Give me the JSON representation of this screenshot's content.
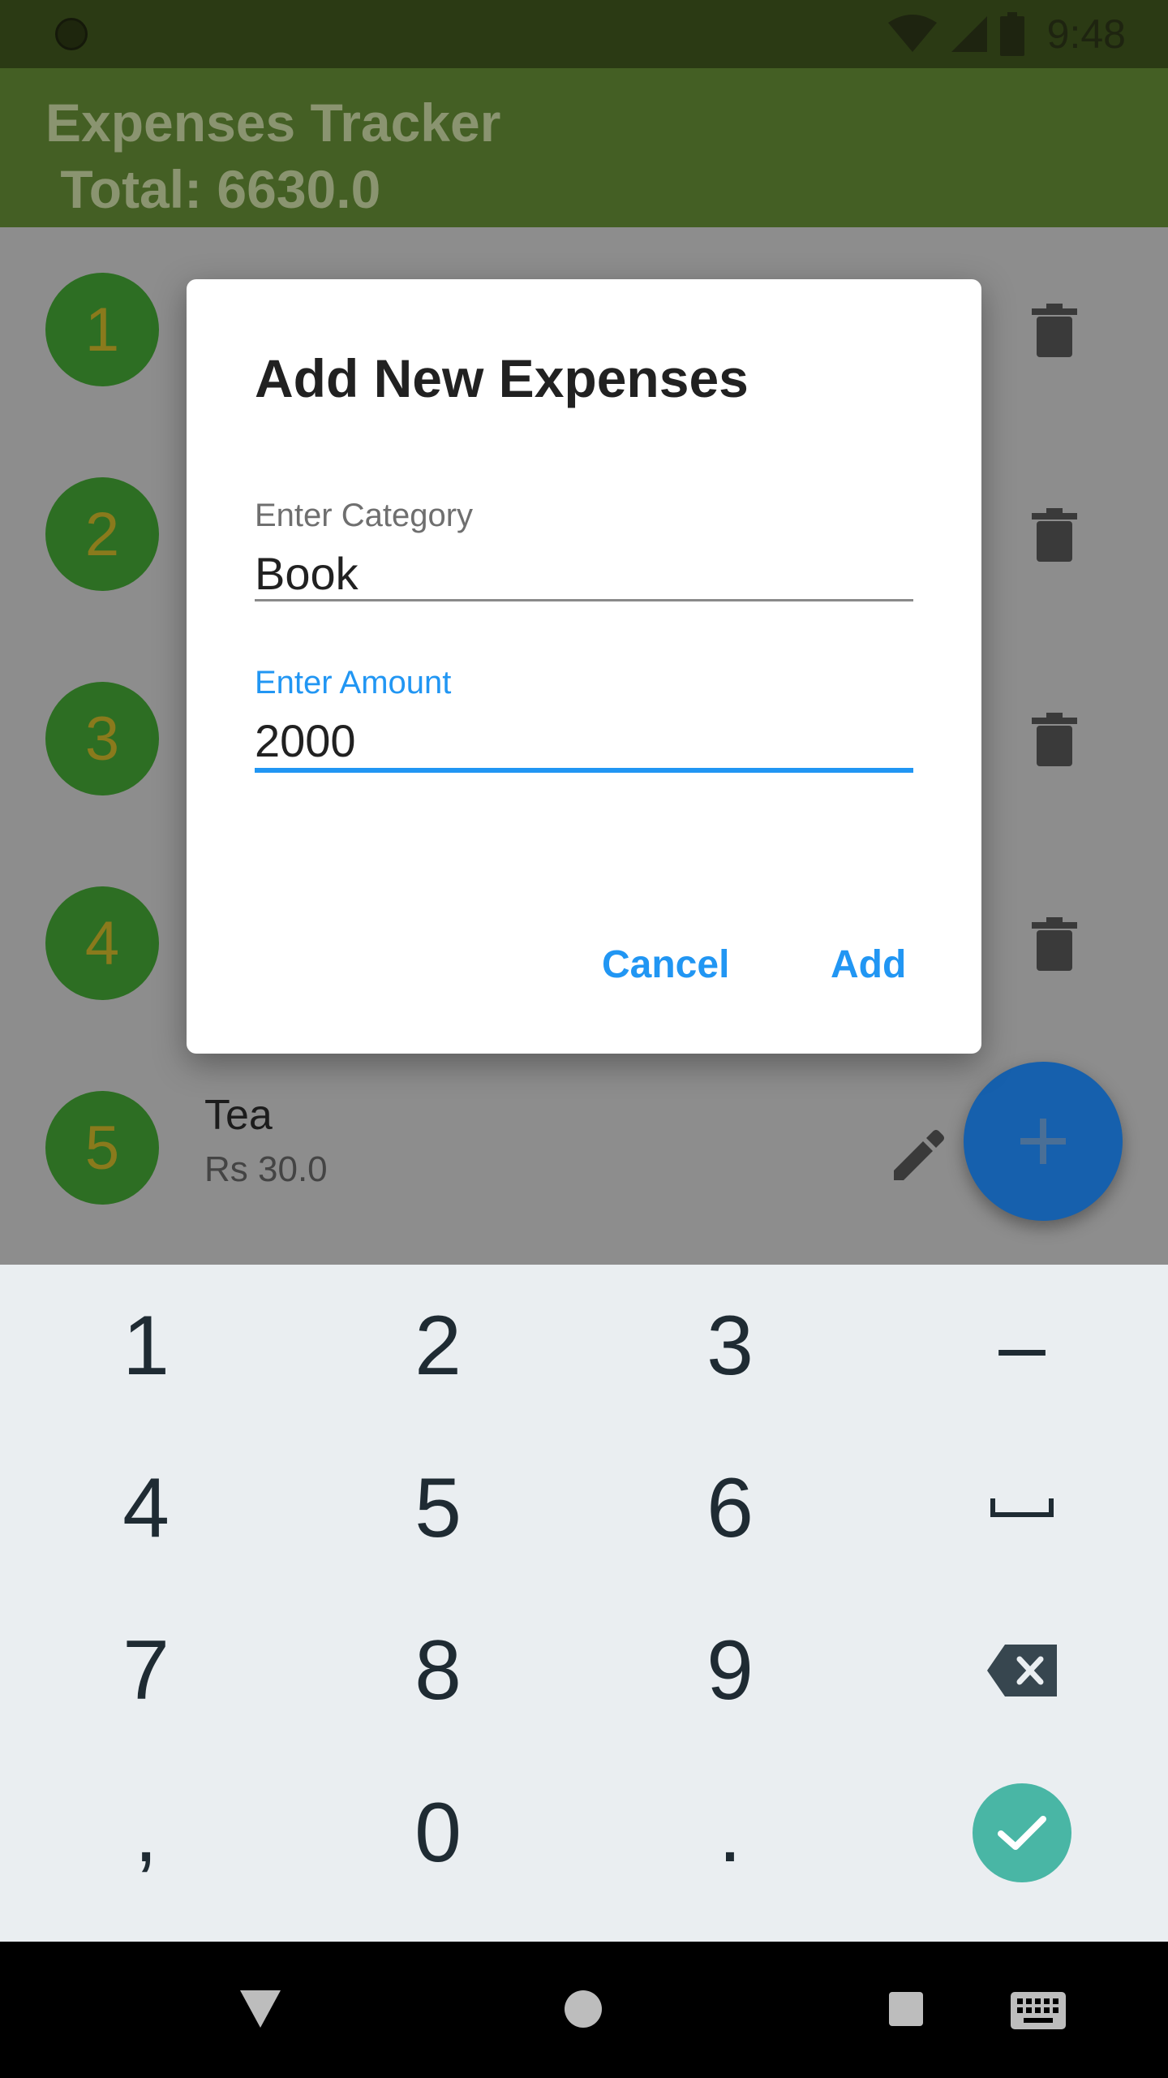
{
  "status_bar": {
    "time": "9:48"
  },
  "app_bar": {
    "title": "Expenses Tracker\n Total: 6630.0"
  },
  "list": {
    "items": [
      {
        "index": "1"
      },
      {
        "index": "2"
      },
      {
        "index": "3"
      },
      {
        "index": "4"
      },
      {
        "index": "5",
        "title": "Tea",
        "amount": "Rs 30.0"
      }
    ]
  },
  "dialog": {
    "title": "Add New Expenses",
    "category_label": "Enter Category",
    "category_value": "Book",
    "amount_label": "Enter Amount",
    "amount_value": "2000",
    "cancel_label": "Cancel",
    "add_label": "Add"
  },
  "keyboard": {
    "keys": [
      "1",
      "2",
      "3",
      "–",
      "4",
      "5",
      "6",
      "",
      "7",
      "8",
      "9",
      "",
      ",",
      "0",
      ".",
      ""
    ]
  },
  "colors": {
    "accent": "#2196f3",
    "app_bar": "#445f24",
    "fab": "#1660ad",
    "avatar": "#2d6e23",
    "done_key": "#49b6a5"
  },
  "icons": {
    "status": [
      "wifi-icon",
      "signal-icon",
      "battery-icon"
    ],
    "list_row": [
      "trash-icon",
      "edit-icon"
    ],
    "fab": "plus-icon",
    "keyboard": [
      "space-icon",
      "backspace-icon",
      "check-icon"
    ],
    "nav": [
      "back-icon",
      "home-icon",
      "recents-icon",
      "keyboard-icon"
    ]
  }
}
